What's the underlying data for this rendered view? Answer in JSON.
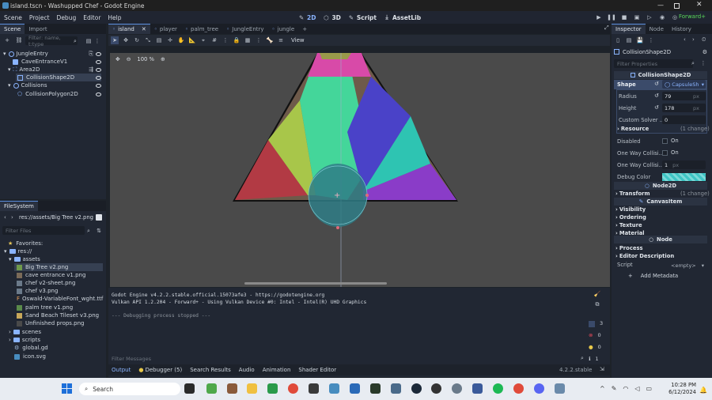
{
  "window": {
    "title": "island.tscn - Washupped Chef - Godot Engine"
  },
  "menu": [
    "Scene",
    "Project",
    "Debug",
    "Editor",
    "Help"
  ],
  "workspaces": [
    {
      "label": "2D",
      "icon": "2d-icon"
    },
    {
      "label": "3D",
      "icon": "3d-icon"
    },
    {
      "label": "Script",
      "icon": "script-icon"
    },
    {
      "label": "AssetLib",
      "icon": "assetlib-icon"
    }
  ],
  "renderer": "Forward+",
  "scene_tabs": {
    "tabs": [
      "Scene",
      "Import"
    ]
  },
  "scene_tree": {
    "filter_placeholder": "Filter: name, t:type",
    "nodes": [
      "JungleEntry",
      "CaveEntranceV1",
      "Area2D",
      "CollisionShape2D",
      "Collisions",
      "CollisionPolygon2D"
    ]
  },
  "filesystem": {
    "tab": "FileSystem",
    "path": "res://assets/Big Tree v2.png",
    "filter_placeholder": "Filter Files",
    "favorites": "Favorites:",
    "root": "res://",
    "folder_assets": "assets",
    "files": [
      "Big Tree v2.png",
      "cave entrance v1.png",
      "chef v2-sheet.png",
      "chef v3.png",
      "Oswald-VariableFont_wght.ttf",
      "palm tree v1.png",
      "Sand Beach Tileset v3.png",
      "Unfinished props.png"
    ],
    "folders": [
      "scenes",
      "scripts"
    ],
    "root_files": [
      "global.gd",
      "icon.svg"
    ]
  },
  "editor_tabs": [
    "island",
    "player",
    "palm_tree",
    "JungleEntry",
    "jungle"
  ],
  "toolbar": {
    "view_label": "View",
    "zoom": "100 %"
  },
  "output": {
    "lines": [
      "Godot Engine v4.2.2.stable.official.15073afe3 - https://godotengine.org",
      "Vulkan API 1.2.204 - Forward+ - Using Vulkan Device #0: Intel - Intel(R) UHD Graphics",
      "",
      "--- Debugging process stopped ---"
    ],
    "filter_placeholder": "Filter Messages",
    "counts": [
      "3",
      "0",
      "0",
      "1"
    ]
  },
  "bottom_tabs": [
    "Output",
    "Debugger (5)",
    "Search Results",
    "Audio",
    "Animation",
    "Shader Editor"
  ],
  "version": "4.2.2.stable",
  "inspector": {
    "tabs": [
      "Inspector",
      "Node",
      "History"
    ],
    "node": "CollisionShape2D",
    "filter_placeholder": "Filter Properties",
    "class_header": "CollisionShape2D",
    "shape_label": "Shape",
    "shape_value": "CapsuleSh",
    "radius_label": "Radius",
    "radius_value": "79",
    "height_label": "Height",
    "height_value": "178",
    "unit": "px",
    "custom_solver_label": "Custom Solver ...",
    "custom_solver_value": "0",
    "resource_label": "Resource",
    "resource_change": "(1 change)",
    "disabled_label": "Disabled",
    "disabled_value": "On",
    "oneway_label": "One Way Collisi...",
    "oneway_value": "On",
    "oneway_margin_label": "One Way Collisi...",
    "oneway_margin_value": "1",
    "debug_color_label": "Debug Color",
    "node2d_header": "Node2D",
    "transform_label": "Transform",
    "transform_change": "(1 change)",
    "canvasitem_header": "CanvasItem",
    "visibility_label": "Visibility",
    "ordering_label": "Ordering",
    "texture_label": "Texture",
    "material_label": "Material",
    "node_header": "Node",
    "process_label": "Process",
    "editor_desc_label": "Editor Description",
    "script_label": "Script",
    "script_value": "<empty>",
    "add_metadata": "Add Metadata"
  },
  "taskbar": {
    "search_placeholder": "Search",
    "time": "10:28 PM",
    "date": "6/12/2024"
  }
}
